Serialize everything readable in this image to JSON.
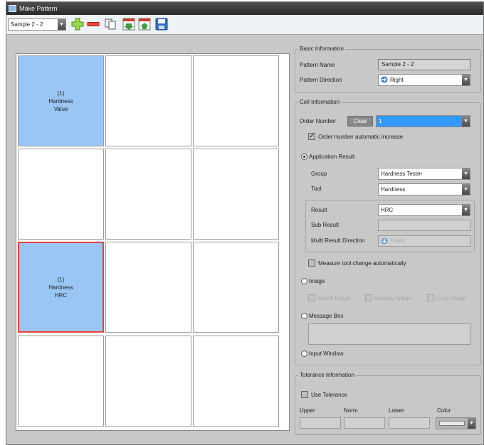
{
  "window": {
    "title": "Make Pattern"
  },
  "toolbar": {
    "pattern_select": "Sample 2 - 2",
    "icons": [
      "add-icon",
      "remove-icon",
      "copy-icon",
      "import-icon",
      "export-icon",
      "save-icon"
    ]
  },
  "grid": {
    "rows": 4,
    "cols": 3,
    "cells": [
      [
        "(1)\nHardness\nValue",
        "",
        ""
      ],
      [
        "",
        "",
        ""
      ],
      [
        "(1)\nHardness\nHRC",
        "",
        ""
      ],
      [
        "",
        "",
        ""
      ]
    ],
    "filled_cells": [
      "0-0",
      "2-0"
    ],
    "selected_cell": "2-0"
  },
  "basic_info": {
    "legend": "Basic Information",
    "pattern_name_label": "Pattern Name",
    "pattern_name_value": "Sample 2 - 2",
    "pattern_direction_label": "Pattern Direction",
    "pattern_direction_value": "Right"
  },
  "cell_info": {
    "legend": "Cell Information",
    "order_number_label": "Order Number",
    "clear_label": "Clear",
    "order_number_value": "1",
    "auto_increase_label": "Order number automatic increase",
    "auto_increase_checked": true,
    "application_result_label": "Application Result",
    "group_label": "Group",
    "group_value": "Hardness Tester",
    "tool_label": "Tool",
    "tool_value": "Hardness",
    "result_label": "Result",
    "result_value": "HRC",
    "sub_result_label": "Sub Result",
    "sub_result_value": "",
    "multi_result_direction_label": "Multi Result Direction",
    "multi_result_direction_value": "Down",
    "measure_tool_change_label": "Measure tool change automatically",
    "image_label": "Image",
    "select_image_label": "Select Image",
    "overlay_image_label": "Overlay Image",
    "crop_image_label": "Crop Image",
    "message_box_label": "Message Box",
    "message_box_value": "",
    "input_window_label": "Input Window"
  },
  "tolerance_info": {
    "legend": "Tolerance Information",
    "use_tolerance_label": "Use Tolerance",
    "upper_label": "Upper",
    "norm_label": "Norm",
    "lower_label": "Lower",
    "color_label": "Color"
  },
  "colors": {
    "cell_fill": "#99c6f4",
    "selected_border": "#e84040",
    "order_highlight": "#3399ff"
  }
}
